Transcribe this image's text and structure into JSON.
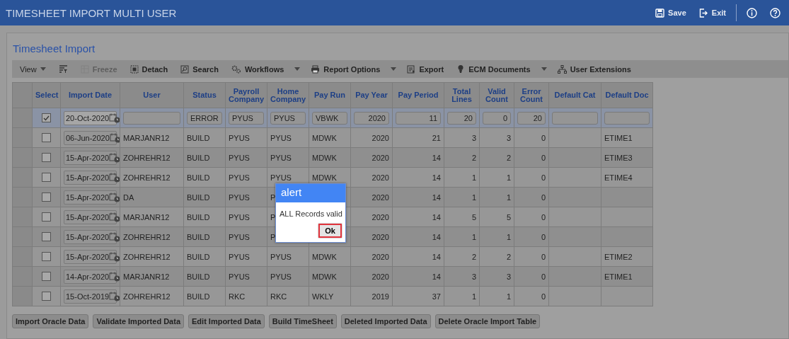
{
  "window": {
    "title": "TIMESHEET IMPORT MULTI USER"
  },
  "header_actions": [
    {
      "kind": "save",
      "label": "Save"
    },
    {
      "kind": "exit",
      "label": "Exit"
    },
    {
      "kind": "info"
    },
    {
      "kind": "help"
    }
  ],
  "panel": {
    "title": "Timesheet Import"
  },
  "toolbar": [
    {
      "kind": "view",
      "label": "View",
      "dropdown": true,
      "disabled": false
    },
    {
      "kind": "filter",
      "dropdown": false,
      "disabled": false
    },
    {
      "kind": "freeze",
      "label": "Freeze",
      "dropdown": false,
      "disabled": true
    },
    {
      "kind": "detach",
      "label": "Detach",
      "dropdown": false,
      "disabled": false
    },
    {
      "kind": "search",
      "label": "Search",
      "dropdown": false,
      "disabled": false
    },
    {
      "kind": "workflows",
      "label": "Workflows",
      "dropdown": true,
      "disabled": false
    },
    {
      "kind": "print",
      "label": "Report Options",
      "dropdown": true,
      "disabled": false
    },
    {
      "kind": "export",
      "label": "Export",
      "dropdown": false,
      "disabled": false
    },
    {
      "kind": "ecm",
      "label": "ECM Documents",
      "dropdown": true,
      "disabled": false
    },
    {
      "kind": "tree",
      "label": "User Extensions",
      "dropdown": false,
      "disabled": false
    }
  ],
  "table": {
    "columns": [
      "Select",
      "Import Date",
      "User",
      "Status",
      "Payroll Company",
      "Home Company",
      "Pay Run",
      "Pay Year",
      "Pay Period",
      "Total Lines",
      "Valid Count",
      "Error Count",
      "Default Cat",
      "Default Doc"
    ],
    "rows": [
      {
        "selected": true,
        "checked": true,
        "import_date": "20-Oct-2020",
        "status": "ERROR",
        "payroll_company": "PYUS",
        "home_company": "PYUS",
        "pay_run": "VBWK",
        "pay_year": "2020",
        "pay_period": "11",
        "total_lines": "20",
        "valid_count": "0",
        "error_count": "20"
      },
      {
        "selected": false,
        "checked": false,
        "import_date": "06-Jun-2020",
        "user": "MARJANR12",
        "status": "BUILD",
        "payroll_company": "PYUS",
        "home_company": "PYUS",
        "pay_run": "MDWK",
        "pay_year": "2020",
        "pay_period": "21",
        "total_lines": "3",
        "valid_count": "3",
        "error_count": "0",
        "default_doc": "ETIME1"
      },
      {
        "selected": false,
        "checked": false,
        "import_date": "15-Apr-2020",
        "user": "ZOHREHR12",
        "status": "BUILD",
        "payroll_company": "PYUS",
        "home_company": "PYUS",
        "pay_run": "MDWK",
        "pay_year": "2020",
        "pay_period": "14",
        "total_lines": "2",
        "valid_count": "2",
        "error_count": "0",
        "default_doc": "ETIME3"
      },
      {
        "selected": false,
        "checked": false,
        "import_date": "15-Apr-2020",
        "user": "ZOHREHR12",
        "status": "BUILD",
        "payroll_company": "PYUS",
        "home_company": "PYUS",
        "pay_run": "MDWK",
        "pay_year": "2020",
        "pay_period": "14",
        "total_lines": "1",
        "valid_count": "1",
        "error_count": "0",
        "default_doc": "ETIME4"
      },
      {
        "selected": false,
        "checked": false,
        "import_date": "15-Apr-2020",
        "user": "DA",
        "status": "BUILD",
        "payroll_company": "PYUS",
        "home_company": "P",
        "pay_year": "2020",
        "pay_period": "14",
        "total_lines": "1",
        "valid_count": "1",
        "error_count": "0"
      },
      {
        "selected": false,
        "checked": false,
        "import_date": "15-Apr-2020",
        "user": "MARJANR12",
        "status": "BUILD",
        "payroll_company": "PYUS",
        "home_company": "P",
        "pay_year": "2020",
        "pay_period": "14",
        "total_lines": "5",
        "valid_count": "5",
        "error_count": "0"
      },
      {
        "selected": false,
        "checked": false,
        "import_date": "15-Apr-2020",
        "user": "ZOHREHR12",
        "status": "BUILD",
        "payroll_company": "PYUS",
        "home_company": "P",
        "pay_year": "2020",
        "pay_period": "14",
        "total_lines": "1",
        "valid_count": "1",
        "error_count": "0"
      },
      {
        "selected": false,
        "checked": false,
        "import_date": "15-Apr-2020",
        "user": "ZOHREHR12",
        "status": "BUILD",
        "payroll_company": "PYUS",
        "home_company": "PYUS",
        "pay_run": "MDWK",
        "pay_year": "2020",
        "pay_period": "14",
        "total_lines": "2",
        "valid_count": "2",
        "error_count": "0",
        "default_doc": "ETIME2"
      },
      {
        "selected": false,
        "checked": false,
        "import_date": "14-Apr-2020",
        "user": "MARJANR12",
        "status": "BUILD",
        "payroll_company": "PYUS",
        "home_company": "PYUS",
        "pay_run": "MDWK",
        "pay_year": "2020",
        "pay_period": "14",
        "total_lines": "3",
        "valid_count": "3",
        "error_count": "0",
        "default_doc": "ETIME1"
      },
      {
        "selected": false,
        "checked": false,
        "import_date": "15-Oct-2019",
        "user": "ZOHREHR12",
        "status": "BUILD",
        "payroll_company": "RKC",
        "home_company": "RKC",
        "pay_run": "WKLY",
        "pay_year": "2019",
        "pay_period": "37",
        "total_lines": "1",
        "valid_count": "1",
        "error_count": "0"
      }
    ]
  },
  "actions": [
    "Import Oracle Data",
    "Validate Imported Data",
    "Edit Imported Data",
    "Build TimeSheet",
    "Deleted Imported Data",
    "Delete Oracle Import Table"
  ],
  "alert": {
    "title": "alert",
    "message": "ALL Records valid",
    "button": "Ok"
  }
}
